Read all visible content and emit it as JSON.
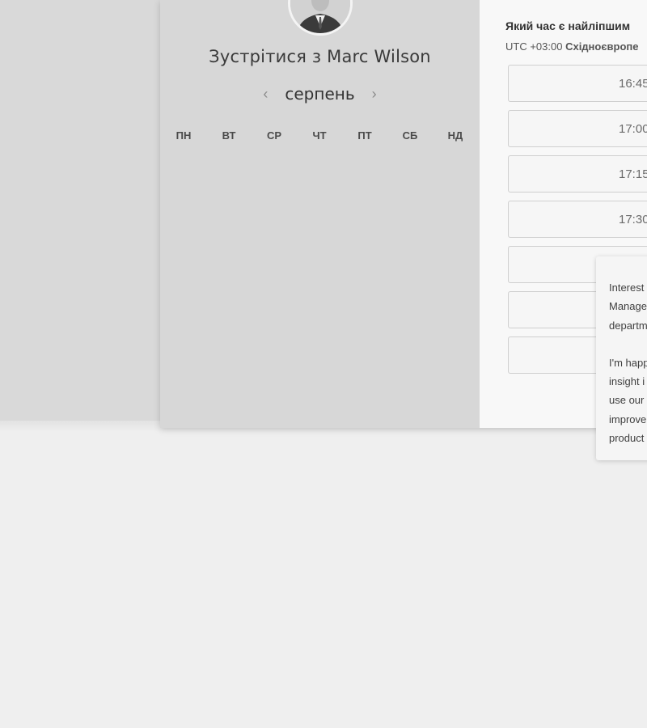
{
  "host": {
    "meeting_title": "Зустрітися з Marc Wilson"
  },
  "calendar": {
    "month": "серпень",
    "prev_icon": "chevron-left-icon",
    "next_icon": "chevron-right-icon",
    "weekdays": [
      "ПН",
      "ВТ",
      "СР",
      "ЧТ",
      "ПТ",
      "СБ",
      "НД"
    ]
  },
  "times": {
    "title": "Який час є найліпшим",
    "timezone_offset": "UTC +03:00",
    "timezone_name": "Східноєвропе",
    "slots": [
      "16:45",
      "17:00",
      "17:15",
      "17:30",
      "",
      "",
      ""
    ]
  },
  "popup": {
    "paragraph1_lines": [
      "Interest",
      "Manage",
      "departm"
    ],
    "paragraph2_lines": [
      "I'm happ",
      "insight i",
      "use our",
      "improve",
      "product"
    ]
  }
}
